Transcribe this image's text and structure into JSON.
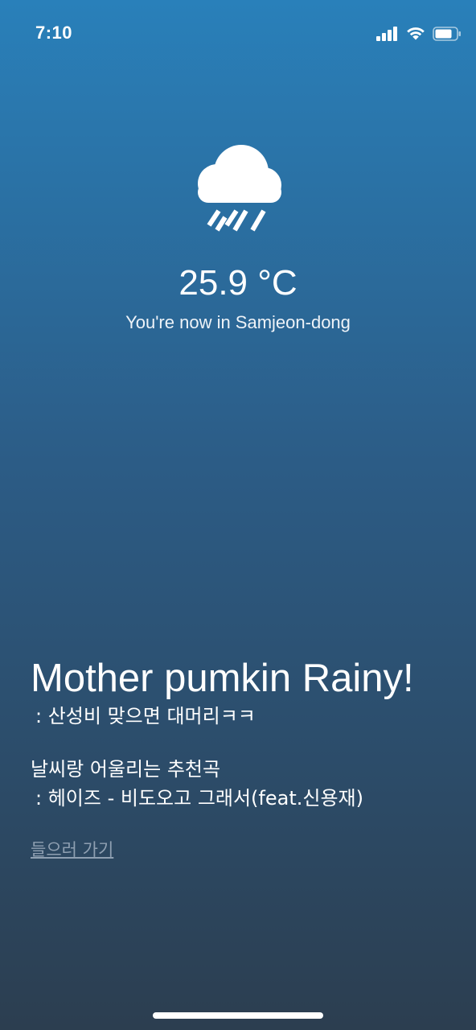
{
  "status_bar": {
    "time": "7:10",
    "icons": [
      "cellular-signal-icon",
      "wifi-icon",
      "battery-icon"
    ]
  },
  "weather": {
    "icon": "rain-cloud-icon",
    "temperature": "25.9 °C",
    "location": "You're now in Samjeon-dong"
  },
  "content": {
    "title": "Mother pumkin Rainy!",
    "subtitle": " : 산성비 맞으면 대머리ㅋㅋ",
    "recommendation_label": "날씨랑 어울리는 추천곡",
    "recommendation_song": " : 헤이즈 - 비도오고 그래서(feat.신용재)",
    "link_label": "들으러 가기"
  },
  "colors": {
    "gradient_top": "#2980ba",
    "gradient_bottom": "#2c3e50",
    "text": "#ffffff",
    "link": "#8fa0b2"
  }
}
